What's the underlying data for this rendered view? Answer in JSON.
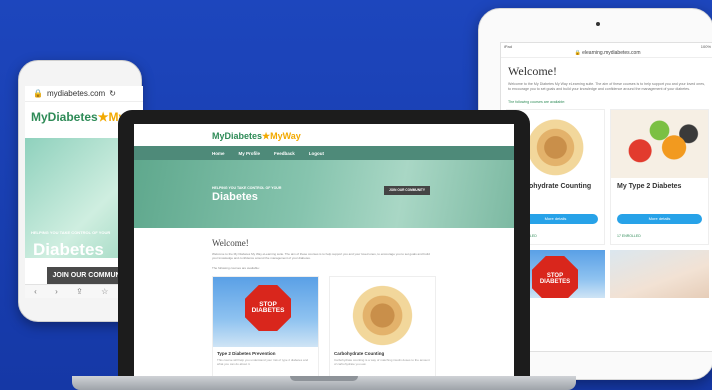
{
  "colors": {
    "background": "#1a3fb0",
    "accent_green": "#2e8b57",
    "nav_green": "#4e8a79",
    "button_blue": "#27a2e8",
    "star_gold": "#f2a900"
  },
  "brand": {
    "my": "My",
    "diabetes": "Diabetes",
    "star": "★",
    "way": "MyWay"
  },
  "phone": {
    "url": "mydiabetes.com",
    "hero_small": "HELPING YOU TAKE CONTROL OF YOUR",
    "hero_title": "Diabetes",
    "join_button": "JOIN OUR COMMUNITY"
  },
  "tablet": {
    "status_left": "iPad",
    "status_right": "100%",
    "url": "elearning.mydiabetes.com",
    "welcome": "Welcome!",
    "intro_text": "Welcome to the My Diabetes My Way eLearning suite. The aim of these courses is to help support you and your loved ones, to encourage you to set goals and build your knowledge and confidence around the management of your diabetes.",
    "available": "The following courses are available:",
    "cards": [
      {
        "title": "Carbohydrate Counting",
        "button": "More details",
        "meta": "15 ENROLLED"
      },
      {
        "title": "My Type 2 Diabetes",
        "button": "More details",
        "meta": "17 ENROLLED"
      }
    ]
  },
  "laptop": {
    "nav": [
      "Home",
      "My Profile",
      "Feedback",
      "Logout"
    ],
    "hero_small": "HELPING YOU TAKE CONTROL OF YOUR",
    "hero_title": "Diabetes",
    "join_button": "JOIN OUR COMMUNITY",
    "welcome": "Welcome!",
    "intro_text": "Welcome to the My Diabetes My Way eLearning suite. The aim of these courses is to help support you and your loved ones, to encourage you to set goals and build your knowledge and confidence around the management of your diabetes.",
    "available": "The following courses are available:",
    "cards": [
      {
        "title": "Type 2 Diabetes Prevention",
        "desc": "This course will help you understand your risk of type 2 diabetes and what you can do about it."
      },
      {
        "title": "Carbohydrate Counting",
        "desc": "Carbohydrate counting is a way of matching insulin doses to the amount of carbohydrate you eat."
      }
    ],
    "stop_sign": {
      "line1": "STOP",
      "line2": "DIABETES"
    }
  }
}
